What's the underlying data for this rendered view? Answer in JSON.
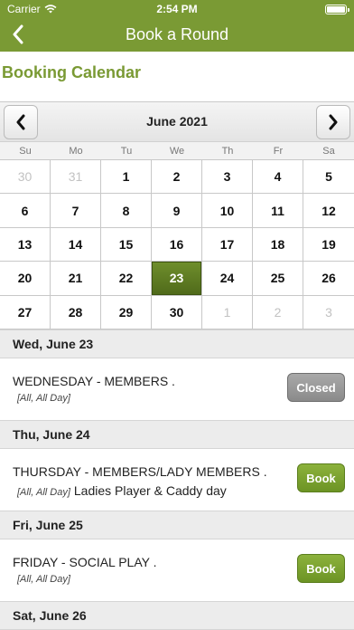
{
  "status_bar": {
    "carrier": "Carrier",
    "time": "2:54 PM",
    "battery_level": 1.0
  },
  "nav": {
    "title": "Book a Round",
    "back_icon": "chevron-left-icon"
  },
  "section_title": "Booking Calendar",
  "calendar": {
    "month_label": "June 2021",
    "weekdays": [
      "Su",
      "Mo",
      "Tu",
      "We",
      "Th",
      "Fr",
      "Sa"
    ],
    "days": [
      {
        "label": "30",
        "muted": true
      },
      {
        "label": "31",
        "muted": true
      },
      {
        "label": "1"
      },
      {
        "label": "2"
      },
      {
        "label": "3"
      },
      {
        "label": "4"
      },
      {
        "label": "5"
      },
      {
        "label": "6"
      },
      {
        "label": "7"
      },
      {
        "label": "8"
      },
      {
        "label": "9"
      },
      {
        "label": "10"
      },
      {
        "label": "11"
      },
      {
        "label": "12"
      },
      {
        "label": "13"
      },
      {
        "label": "14"
      },
      {
        "label": "15"
      },
      {
        "label": "16"
      },
      {
        "label": "17"
      },
      {
        "label": "18"
      },
      {
        "label": "19"
      },
      {
        "label": "20"
      },
      {
        "label": "21"
      },
      {
        "label": "22"
      },
      {
        "label": "23",
        "selected": true
      },
      {
        "label": "24"
      },
      {
        "label": "25"
      },
      {
        "label": "26"
      },
      {
        "label": "27"
      },
      {
        "label": "28"
      },
      {
        "label": "29"
      },
      {
        "label": "30"
      },
      {
        "label": "1",
        "muted": true
      },
      {
        "label": "2",
        "muted": true
      },
      {
        "label": "3",
        "muted": true
      }
    ]
  },
  "schedule": [
    {
      "header": "Wed, June 23",
      "event": {
        "name": "WEDNESDAY - MEMBERS .",
        "tag": "[All, All Day]",
        "description": "",
        "action": "Closed",
        "action_type": "closed"
      }
    },
    {
      "header": "Thu, June 24",
      "event": {
        "name": "THURSDAY - MEMBERS/LADY MEMBERS .",
        "tag": "[All, All Day]",
        "description": "Ladies Player & Caddy day",
        "action": "Book",
        "action_type": "book"
      }
    },
    {
      "header": "Fri, June 25",
      "event": {
        "name": "FRIDAY - SOCIAL PLAY .",
        "tag": "[All, All Day]",
        "description": "",
        "action": "Book",
        "action_type": "book"
      }
    },
    {
      "header": "Sat, June 26"
    }
  ],
  "colors": {
    "brand": "#7a9a34",
    "selected_day": "#5b7a22",
    "book_button": "#7aa22e",
    "closed_button": "#999999"
  }
}
